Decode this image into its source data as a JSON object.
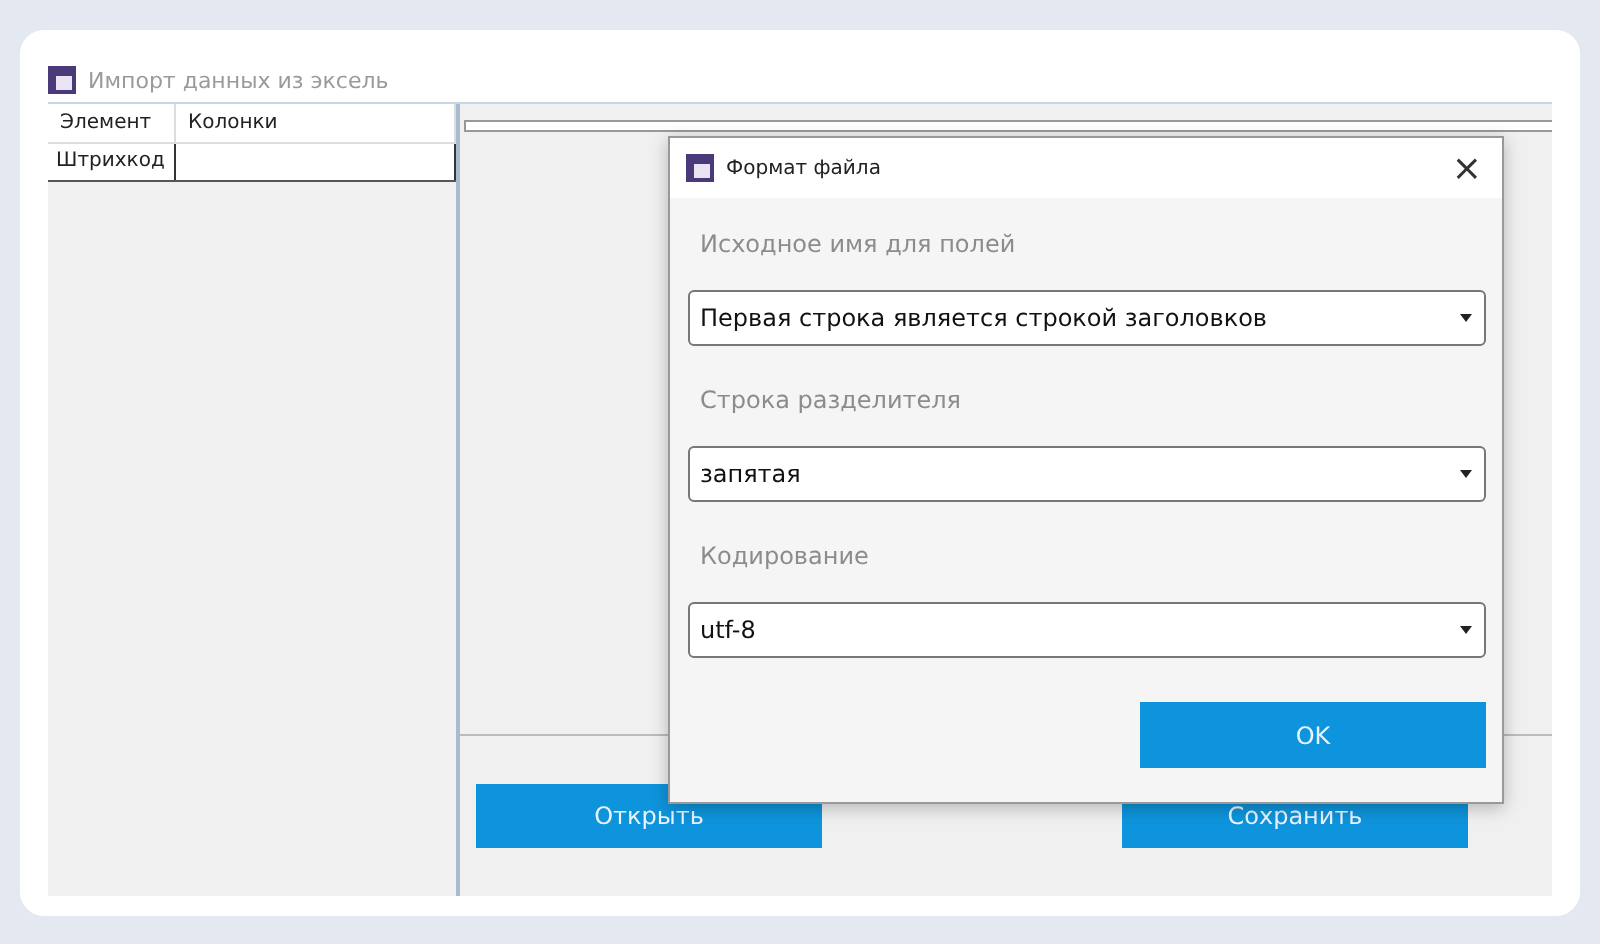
{
  "window": {
    "title": "Импорт данных из эксель"
  },
  "table": {
    "columns": [
      "Элемент",
      "Колонки"
    ],
    "rows": [
      [
        "Штрихкод",
        ""
      ]
    ]
  },
  "buttons": [
    "Открыть",
    "Сохранить"
  ],
  "dialog": {
    "title": "Формат файла",
    "close": "×",
    "fields": [
      {
        "label": "Исходное имя для полей",
        "value": "Первая строка является строкой заголовков"
      },
      {
        "label": "Строка разделителя",
        "value": "запятая"
      },
      {
        "label": "Кодирование",
        "value": "utf-8"
      }
    ],
    "ok": "OK"
  }
}
